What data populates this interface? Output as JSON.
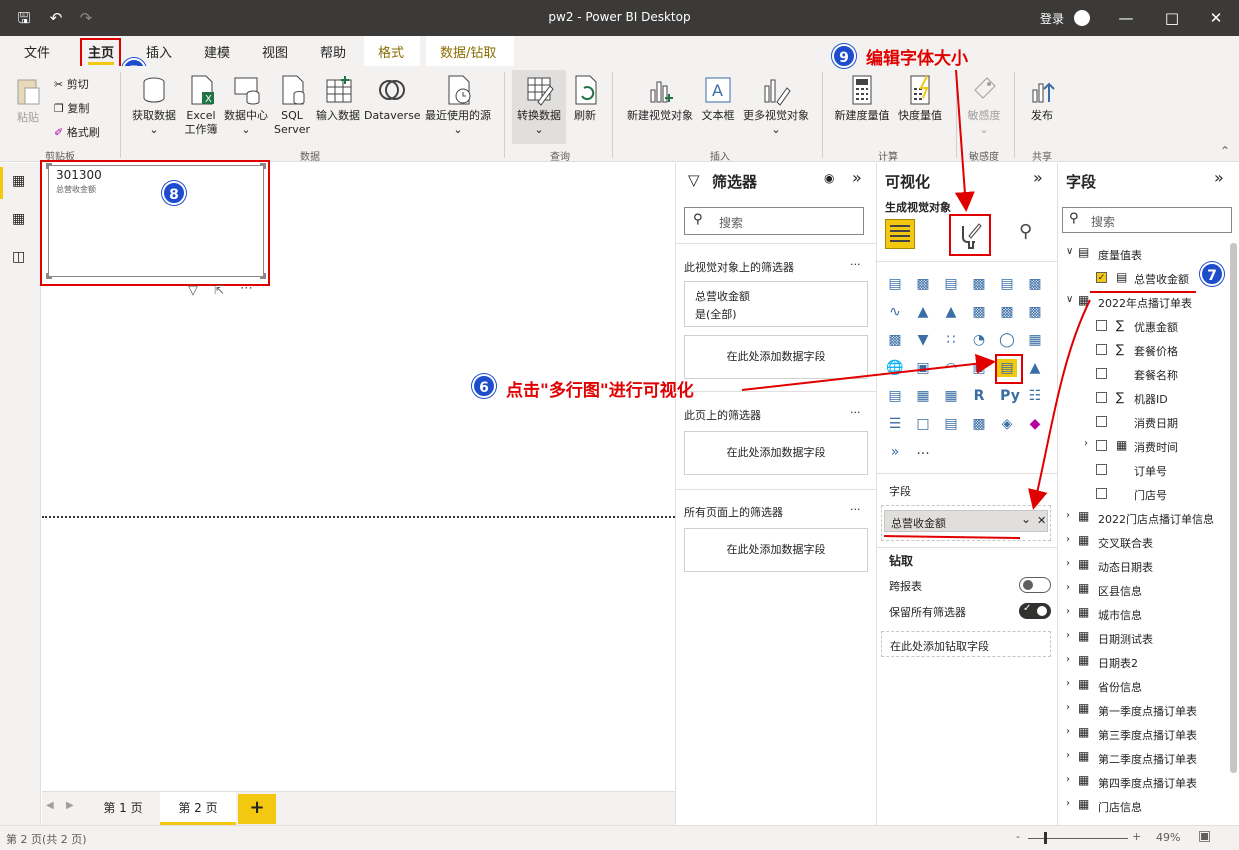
{
  "window": {
    "title": "pw2 - Power BI Desktop",
    "login": "登录"
  },
  "tabs": [
    "文件",
    "主页",
    "插入",
    "建模",
    "视图",
    "帮助",
    "格式",
    "数据/钻取"
  ],
  "ribbon": {
    "clipboard": {
      "paste": "粘贴",
      "cut": "剪切",
      "copy": "复制",
      "format_painter": "格式刷",
      "group": "剪贴板"
    },
    "data": {
      "get_data": "获取数据",
      "excel": "Excel",
      "excel2": "工作簿",
      "data_hub": "数据中心",
      "sql": "SQL",
      "sql2": "Server",
      "enter_data": "输入数据",
      "dataverse": "Dataverse",
      "recent": "最近使用的源",
      "group": "数据"
    },
    "query": {
      "transform": "转换数据",
      "refresh": "刷新",
      "group": "查询"
    },
    "insert": {
      "new_visual": "新建视觉对象",
      "textbox": "文本框",
      "more_visuals": "更多视觉对象",
      "group": "插入"
    },
    "calc": {
      "new_measure": "新建度量值",
      "quick_measure": "快度量值",
      "group": "计算"
    },
    "sensitivity": {
      "label": "敏感度",
      "group": "敏感度"
    },
    "share": {
      "publish": "发布",
      "group": "共享"
    }
  },
  "visual": {
    "value": "301300",
    "label": "总营收金额"
  },
  "filters": {
    "title": "筛选器",
    "search": "搜索",
    "on_visual": "此视觉对象上的筛选器",
    "card_field": "总营收金额",
    "card_value": "是(全部)",
    "add_field": "在此处添加数据字段",
    "on_page": "此页上的筛选器",
    "on_all": "所有页面上的筛选器",
    "more": "..."
  },
  "viz": {
    "title": "可视化",
    "build": "生成视觉对象",
    "fields_label": "字段",
    "field_value": "总营收金额",
    "drill": "钻取",
    "cross_report": "跨报表",
    "keep_filters": "保留所有筛选器",
    "add_drill": "在此处添加钻取字段",
    "r_label": "R",
    "py_label": "Py",
    "more": "..."
  },
  "fields": {
    "title": "字段",
    "search": "搜索",
    "tables": [
      {
        "name": "度量值表",
        "expanded": true,
        "items": [
          {
            "name": "总营收金额",
            "checked": true,
            "kind": "calc"
          }
        ]
      },
      {
        "name": "2022年点播订单表",
        "expanded": true,
        "items": [
          {
            "name": "优惠金额",
            "kind": "sum"
          },
          {
            "name": "套餐价格",
            "kind": "sum"
          },
          {
            "name": "套餐名称",
            "kind": ""
          },
          {
            "name": "机器ID",
            "kind": "sum"
          },
          {
            "name": "消费日期",
            "kind": ""
          },
          {
            "name": "消费时间",
            "kind": "cal"
          },
          {
            "name": "订单号",
            "kind": ""
          },
          {
            "name": "门店号",
            "kind": ""
          }
        ]
      },
      {
        "name": "2022门店点播订单信息"
      },
      {
        "name": "交叉联合表"
      },
      {
        "name": "动态日期表"
      },
      {
        "name": "区县信息"
      },
      {
        "name": "城市信息"
      },
      {
        "name": "日期测试表"
      },
      {
        "name": "日期表2"
      },
      {
        "name": "省份信息"
      },
      {
        "name": "第一季度点播订单表"
      },
      {
        "name": "第三季度点播订单表"
      },
      {
        "name": "第二季度点播订单表"
      },
      {
        "name": "第四季度点播订单表"
      },
      {
        "name": "门店信息"
      }
    ]
  },
  "pages": {
    "tabs": [
      "第 1 页",
      "第 2 页"
    ],
    "add": "+"
  },
  "status": {
    "pages": "第 2 页(共 2 页)",
    "zoom": "49%",
    "minus": "-",
    "plus": "+"
  },
  "annotations": {
    "a5": "5",
    "a6": "6",
    "a6_text": "点击\"多行图\"进行可视化",
    "a7": "7",
    "a8": "8",
    "a9": "9",
    "a9_text": "编辑字体大小"
  },
  "colors": {
    "accent": "#f2c811",
    "annotation": "#e00000",
    "badge": "#1d4dcc",
    "titlebar": "#3b3a39"
  }
}
